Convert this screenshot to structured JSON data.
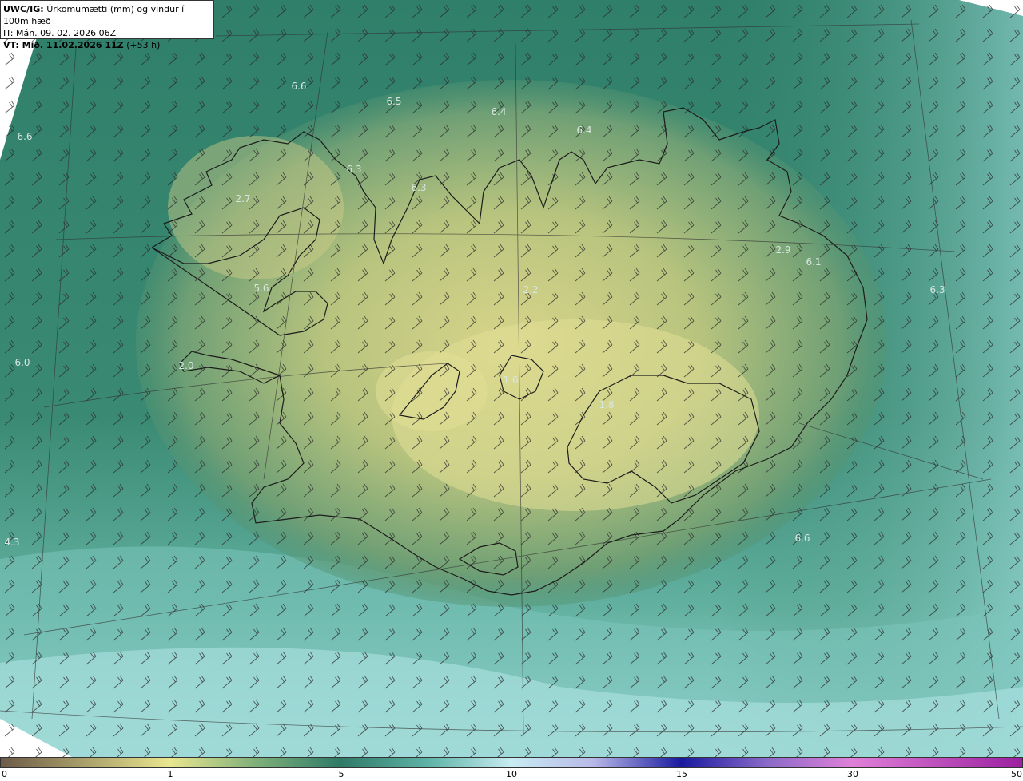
{
  "header": {
    "model": "UWC/IG:",
    "title": "Úrkomumætti (mm) og vindur í 100m hæð",
    "it_line": "IT: Mán. 09. 02. 2026 06Z",
    "vt_label": "VT: Mið. 11.02.2026 11Z",
    "vt_offset": "(+53 h)"
  },
  "map_values": [
    {
      "id": "v1",
      "text": "6.6"
    },
    {
      "id": "v2",
      "text": "6.5"
    },
    {
      "id": "v3",
      "text": "6.4"
    },
    {
      "id": "v4",
      "text": "6.4"
    },
    {
      "id": "v5",
      "text": "6.6"
    },
    {
      "id": "v6",
      "text": "6.3"
    },
    {
      "id": "v7",
      "text": "6.3"
    },
    {
      "id": "v8",
      "text": "2.7"
    },
    {
      "id": "v9",
      "text": "2.9"
    },
    {
      "id": "v10",
      "text": "6.1"
    },
    {
      "id": "v11",
      "text": "6.3"
    },
    {
      "id": "v12",
      "text": "5.6"
    },
    {
      "id": "v13",
      "text": "2.2"
    },
    {
      "id": "v14",
      "text": "6.0"
    },
    {
      "id": "v15",
      "text": "2.0"
    },
    {
      "id": "v16",
      "text": "1.6"
    },
    {
      "id": "v17",
      "text": "1.8"
    },
    {
      "id": "v18",
      "text": "4.3"
    },
    {
      "id": "v19",
      "text": "6.6"
    }
  ],
  "colorbar": {
    "ticks": [
      "0",
      "1",
      "5",
      "10",
      "15",
      "30",
      "50"
    ],
    "colors": [
      "#6b5a47",
      "#c9b57c",
      "#e9e68f",
      "#2f7a67",
      "#8fe0e0",
      "#e2f5ff",
      "#c8c8f0",
      "#1a1aa0",
      "#d070d0",
      "#9b1fa0"
    ]
  }
}
